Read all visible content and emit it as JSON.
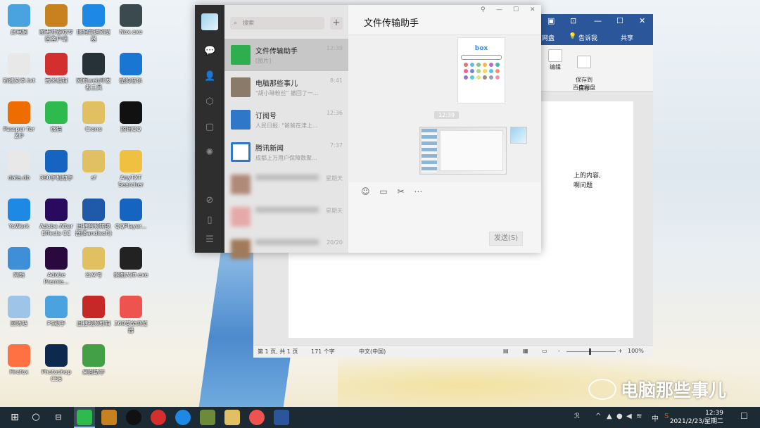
{
  "desktop_icons": [
    {
      "label": "此电脑",
      "color": "#4aa3df",
      "col": 0,
      "row": 0
    },
    {
      "label": "图老师游戏专区客户端",
      "color": "#c8811f",
      "col": 1,
      "row": 0
    },
    {
      "label": "搜狗高速浏览器",
      "color": "#1e88e5",
      "col": 2,
      "row": 0
    },
    {
      "label": "Nox.exe",
      "color": "#3b4a4e",
      "col": 3,
      "row": 0
    },
    {
      "label": "新建文本.txt",
      "color": "#e8e8e8",
      "col": 0,
      "row": 1
    },
    {
      "label": "秀米编辑",
      "color": "#d32f2f",
      "col": 1,
      "row": 1
    },
    {
      "label": "网页web开发者工具",
      "color": "#263238",
      "col": 2,
      "row": 1
    },
    {
      "label": "酷狗音乐",
      "color": "#1976d2",
      "col": 3,
      "row": 1
    },
    {
      "label": "Passper for ZIP",
      "color": "#ef6c00",
      "col": 0,
      "row": 2
    },
    {
      "label": "微信",
      "color": "#2dbb4d",
      "col": 1,
      "row": 2
    },
    {
      "label": "Crone",
      "color": "#e0c060",
      "col": 2,
      "row": 2
    },
    {
      "label": "腾讯QQ",
      "color": "#111111",
      "col": 3,
      "row": 2
    },
    {
      "label": "data.db",
      "color": "#e8e8e8",
      "col": 0,
      "row": 3
    },
    {
      "label": "360手机助手",
      "color": "#1565c0",
      "col": 1,
      "row": 3
    },
    {
      "label": "sf",
      "color": "#e0c060",
      "col": 2,
      "row": 3
    },
    {
      "label": "AnyTXT Searcher",
      "color": "#f0c040",
      "col": 3,
      "row": 3
    },
    {
      "label": "YoWerk",
      "color": "#1e88e5",
      "col": 0,
      "row": 4
    },
    {
      "label": "Adobe After Effects CC",
      "color": "#2a0a5e",
      "col": 1,
      "row": 4
    },
    {
      "label": "迅捷音频转换器(Bandisoft)",
      "color": "#1e5aa8",
      "col": 2,
      "row": 4
    },
    {
      "label": "QQPlayer...",
      "color": "#1565c0",
      "col": 3,
      "row": 4
    },
    {
      "label": "网络",
      "color": "#3f8fd8",
      "col": 0,
      "row": 5
    },
    {
      "label": "Adobe Premie...",
      "color": "#2a0a3e",
      "col": 1,
      "row": 5
    },
    {
      "label": "公众号",
      "color": "#e0c060",
      "col": 2,
      "row": 5
    },
    {
      "label": "抠图大师.exe",
      "color": "#222222",
      "col": 3,
      "row": 5
    },
    {
      "label": "回收站",
      "color": "#9ec4e8",
      "col": 0,
      "row": 6
    },
    {
      "label": "PS助手",
      "color": "#4aa3df",
      "col": 1,
      "row": 6
    },
    {
      "label": "迅捷视频剪辑",
      "color": "#c62828",
      "col": 2,
      "row": 6
    },
    {
      "label": "360安全浏览器",
      "color": "#ef5350",
      "col": 3,
      "row": 6
    },
    {
      "label": "Firefox",
      "color": "#ff7043",
      "col": 0,
      "row": 7
    },
    {
      "label": "Photoshop CS6",
      "color": "#0d2a4e",
      "col": 1,
      "row": 7
    },
    {
      "label": "桌面助手",
      "color": "#43a047",
      "col": 2,
      "row": 7
    }
  ],
  "wechat": {
    "search_placeholder": "搜索",
    "plus_label": "+",
    "window_title": "文件传输助手",
    "chats": [
      {
        "name": "文件传输助手",
        "preview": "[图片]",
        "time": "12:39",
        "selected": true,
        "avatar_color": "#2fae4f",
        "blurred": false
      },
      {
        "name": "电脑那些事儿",
        "preview": "\"胡小琳粉丝\" 撤回了一...",
        "time": "8:41",
        "selected": false,
        "avatar_color": "#8a7a6a",
        "blurred": false
      },
      {
        "name": "订阅号",
        "preview": "人民日报: \"爸爸在津上...",
        "time": "12:36",
        "selected": false,
        "avatar_color": "#2f78c8",
        "blurred": false
      },
      {
        "name": "腾讯新闻",
        "preview": "成都上万用户保障数聚...",
        "time": "7:37",
        "selected": false,
        "avatar_color": "#ffffff",
        "blurred": false
      },
      {
        "name": "",
        "preview": "",
        "time": "星期天",
        "selected": false,
        "avatar_color": "#b08a78",
        "blurred": true
      },
      {
        "name": "",
        "preview": "",
        "time": "星期天",
        "selected": false,
        "avatar_color": "#e6a9a9",
        "blurred": true
      },
      {
        "name": "",
        "preview": "",
        "time": "20/20",
        "selected": false,
        "avatar_color": "#a07a5a",
        "blurred": true
      }
    ],
    "time_chip": "12:39",
    "image1_logo": "box",
    "send_label": "发送(S)",
    "dot_colors": [
      "#e57373",
      "#64b5f6",
      "#81c784",
      "#ffb74d",
      "#ba68c8",
      "#4db6ac",
      "#f06292",
      "#7986cb",
      "#aed581",
      "#ffd54f",
      "#4fc3f7",
      "#ff8a65",
      "#9575cd",
      "#4dd0e1",
      "#dce775",
      "#a1887f",
      "#90a4ae",
      "#f48fb1"
    ]
  },
  "word": {
    "tabs": [
      "网盘",
      "告诉我",
      "共享"
    ],
    "ribbon_edit": "编辑",
    "ribbon_save": "保存到\n百度网盘",
    "ribbon_group": "保存",
    "doc_lines": [
      "上的内容,",
      "啊问题"
    ],
    "status_page": "第 1 页, 共 1 页",
    "status_words": "171 个字",
    "status_lang": "中文(中国)",
    "zoom": "100%"
  },
  "watermark": "电脑那些事儿",
  "taskbar": {
    "time": "12:39",
    "date": "2021/2/23/星期二",
    "ime": "中"
  }
}
